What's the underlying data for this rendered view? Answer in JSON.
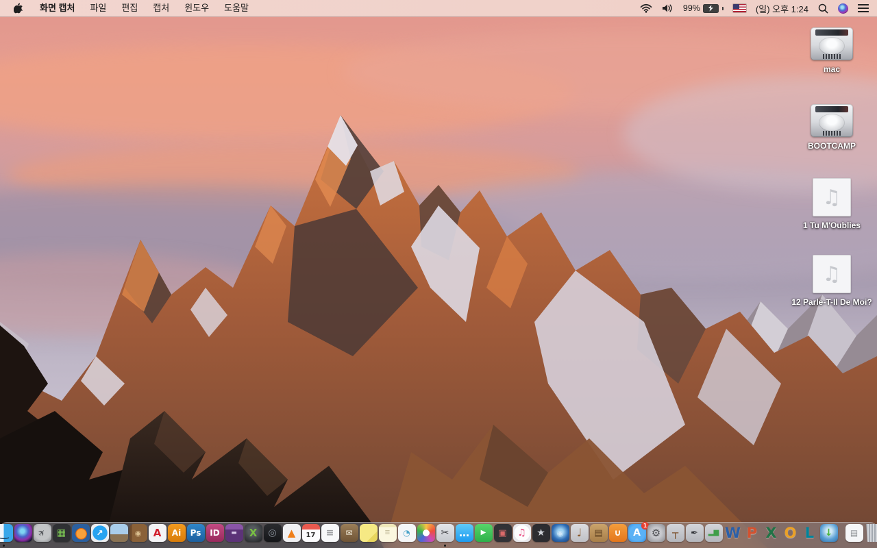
{
  "menu_bar": {
    "app_name": "화면 캡처",
    "menus": [
      "파일",
      "편집",
      "캡처",
      "윈도우",
      "도움말"
    ],
    "status": {
      "battery_percent": "99%",
      "battery_state": "charging",
      "clock": "(일) 오후 1:24",
      "input_source": "us-flag",
      "icon_names": [
        "wifi-icon",
        "volume-icon",
        "battery-charging-icon",
        "keyboard-flag-icon",
        "spotlight-icon",
        "siri-icon",
        "notification-center-icon"
      ]
    }
  },
  "desktop": {
    "wallpaper": "macos-sierra-mountain-sunset",
    "icons": [
      {
        "label": "mac",
        "type": "hard-drive"
      },
      {
        "label": "BOOTCAMP",
        "type": "hard-drive"
      },
      {
        "label": "1 Tu M'Oublies",
        "type": "audio-file",
        "glyph": "♫"
      },
      {
        "label": "12 Parle-T-Il De Moi?",
        "type": "audio-file",
        "glyph": "♫"
      }
    ]
  },
  "dock": {
    "apps": [
      {
        "name": "finder",
        "bg": "linear-gradient(90deg,#f2f6fa 0 49%,#39a7ea 49% 100%)",
        "glyph": "‿",
        "fg": "#1c3d5a",
        "fs": 17,
        "running": true
      },
      {
        "name": "siri",
        "bg": "radial-gradient(circle at 45% 40%,#7fd4f2 0 14%,#4a63c9 40%,#902ea8 62%,#121430 86%)",
        "glyph": ""
      },
      {
        "name": "launchpad",
        "bg": "radial-gradient(circle at 50% 45%,#c3c5c7 0 58%,#86898d 100%)",
        "glyph": "✈",
        "fg": "#4c4f54",
        "fs": 13,
        "tilt": -45
      },
      {
        "name": "mission-control",
        "bg": "#2f3033",
        "glyph": "▦",
        "fg": "#7dc855",
        "fs": 14
      },
      {
        "name": "firefox",
        "bg": "radial-gradient(circle at 52% 55%,#f9a13b 0 36%,#e06b12 37% 42%,#2b5f9e 43% 100%)",
        "glyph": ""
      },
      {
        "name": "safari",
        "bg": "radial-gradient(circle at 50% 50%,#27a3f0 0 58%,#eceef0 59% 100%)",
        "glyph": "↗",
        "fg": "#ffffff",
        "fs": 12
      },
      {
        "name": "preview",
        "bg": "linear-gradient(180deg,#a9cdea 0 58%,#8a7354 58% 100%)",
        "glyph": ""
      },
      {
        "name": "contacts",
        "bg": "linear-gradient(90deg,#6d4a2b 0 14%,#8a6138 14% 100%)",
        "glyph": "◉",
        "fg": "#d9bd8d",
        "fs": 11
      },
      {
        "name": "acrobat",
        "bg": "#f4f4f6",
        "glyph": "A",
        "fg": "#d2202f",
        "fs": 15
      },
      {
        "name": "illustrator",
        "bg": "linear-gradient(180deg,#f39a1e,#d97c0a)",
        "glyph": "Ai",
        "fg": "#ffffff",
        "fs": 12
      },
      {
        "name": "photoshop",
        "bg": "linear-gradient(180deg,#2f86c9,#1d5f9e)",
        "glyph": "Ps",
        "fg": "#ffffff",
        "fs": 12
      },
      {
        "name": "indesign",
        "bg": "linear-gradient(180deg,#c24a82,#98295c)",
        "glyph": "ID",
        "fg": "#ffffff",
        "fs": 12
      },
      {
        "name": "toast",
        "bg": "linear-gradient(180deg,#8a55a8 0 30%,#5c3378 30% 100%)",
        "glyph": "▬",
        "fg": "#d8c8e8",
        "fs": 9
      },
      {
        "name": "green-x-app",
        "bg": "radial-gradient(circle at 45% 40%,#555a5e 0 30%,#1c1e20 100%)",
        "glyph": "X",
        "fg": "#79c043",
        "fs": 15
      },
      {
        "name": "disc-drive-app",
        "bg": "linear-gradient(180deg,#2a2b2e,#151619)",
        "glyph": "◎",
        "fg": "#8f96a0",
        "fs": 14
      },
      {
        "name": "vlc",
        "bg": "#f0f0f2",
        "glyph": "▲",
        "fg": "#ef7f1a",
        "fs": 15
      },
      {
        "name": "calendar",
        "bg": "linear-gradient(180deg,#e9594e 0 30%,#fbfbfd 30% 100%)",
        "glyph": "17",
        "fg": "#333333",
        "fs": 10,
        "cls": "cal"
      },
      {
        "name": "reminders",
        "bg": "#f7f8f9",
        "glyph": "≡",
        "fg": "#9a9b9e",
        "fs": 14
      },
      {
        "name": "mailbox-app",
        "bg": "linear-gradient(180deg,#9b7e58,#6f5436)",
        "glyph": "✉",
        "fg": "#f0ead8",
        "fs": 12
      },
      {
        "name": "stickies",
        "bg": "linear-gradient(135deg,#f6e984 0 70%,#e8d65e 70% 100%)",
        "glyph": ""
      },
      {
        "name": "notepad-app",
        "bg": "linear-gradient(180deg,#efe6b8 0 18%,#fbf7df 18% 100%)",
        "glyph": "≡",
        "fg": "#c9c2a0",
        "fs": 10
      },
      {
        "name": "planner-app",
        "bg": "#f5f6f7",
        "glyph": "◔",
        "fg": "#4aa3c9",
        "fs": 12
      },
      {
        "name": "photos",
        "bg": "radial-gradient(circle at 50% 50%,#ffffff 0 26%,rgba(255,255,255,0) 27%),conic-gradient(#f6c344,#ef4d3c,#c94bb5,#4a67d8,#39b54a,#f6c344)",
        "glyph": ""
      },
      {
        "name": "grab-screen-capture",
        "bg": "linear-gradient(180deg,#e3e5e9,#c6c9cf)",
        "glyph": "✂",
        "fg": "#3c3e42",
        "fs": 14,
        "running": true
      },
      {
        "name": "messages",
        "bg": "linear-gradient(180deg,#5fc9f8,#1d9bf0)",
        "glyph": "…",
        "fg": "#ffffff",
        "fs": 15
      },
      {
        "name": "facetime",
        "bg": "linear-gradient(180deg,#57d46a,#2eb14a)",
        "glyph": "▶",
        "fg": "#ffffff",
        "fs": 10
      },
      {
        "name": "photo-booth",
        "bg": "#323236",
        "glyph": "▣",
        "fg": "#d96a6a",
        "fs": 13
      },
      {
        "name": "itunes",
        "bg": "radial-gradient(circle,#fdfdfd 0 62%,#e8e8ec 63% 100%)",
        "glyph": "♫",
        "fg": "#e8457e",
        "fs": 14
      },
      {
        "name": "imovie",
        "bg": "#2c2c30",
        "glyph": "★",
        "fg": "#cfd2d8",
        "fs": 14
      },
      {
        "name": "dvd-app",
        "bg": "radial-gradient(circle at 50% 45%,#9ed1f2 0 22%,#2e6cb4 60%,#1b3f74 100%)",
        "glyph": "◉",
        "fg": "#cfe6f8",
        "fs": 11
      },
      {
        "name": "garageband",
        "bg": "linear-gradient(180deg,#dcdce0,#bfc0c6)",
        "glyph": "♩",
        "fg": "#8a5a2e",
        "fs": 16
      },
      {
        "name": "newsstand-app",
        "bg": "linear-gradient(180deg,#caa36b,#a87f49)",
        "glyph": "▤",
        "fg": "#5e4020",
        "fs": 13
      },
      {
        "name": "ibooks",
        "bg": "linear-gradient(180deg,#f49d3c,#e4761b)",
        "glyph": "∪",
        "fg": "#ffffff",
        "fs": 13
      },
      {
        "name": "app-store",
        "bg": "radial-gradient(circle,#5ab1f5 0 60%,#2f8ae0 100%)",
        "glyph": "A",
        "fg": "#ffffff",
        "fs": 14,
        "badge": "1"
      },
      {
        "name": "system-preferences",
        "bg": "radial-gradient(circle,#c8c9ce 0 40%,#88898e 100%)",
        "glyph": "⚙",
        "fg": "#4b4c50",
        "fs": 15
      },
      {
        "name": "keynote",
        "bg": "linear-gradient(180deg,#d3d5da,#b4b6bc)",
        "glyph": "┬",
        "fg": "#7a4e28",
        "fs": 15
      },
      {
        "name": "pages",
        "bg": "linear-gradient(180deg,#d3d5da,#b4b6bc)",
        "glyph": "✒",
        "fg": "#35373c",
        "fs": 13
      },
      {
        "name": "numbers",
        "bg": "linear-gradient(180deg,#d3d5da,#b4b6bc)",
        "glyph": "▂▆",
        "fg": "#3f9e49",
        "fs": 10
      },
      {
        "name": "word",
        "bg": "",
        "glyph": "W",
        "fg": "#2b5fa8",
        "cls": "office"
      },
      {
        "name": "powerpoint",
        "bg": "",
        "glyph": "P",
        "fg": "#d35230",
        "cls": "office"
      },
      {
        "name": "excel",
        "bg": "",
        "glyph": "X",
        "fg": "#217346",
        "cls": "office"
      },
      {
        "name": "outlook",
        "bg": "",
        "glyph": "O",
        "fg": "#eba127",
        "cls": "office"
      },
      {
        "name": "lync",
        "bg": "",
        "glyph": "L",
        "fg": "#00839a",
        "cls": "office"
      },
      {
        "name": "web-downloader",
        "bg": "radial-gradient(circle at 50% 40%,#cfe8f5 0 20%,#5a9fd4 60%,#2f6ea8 100%)",
        "glyph": "↓",
        "fg": "#49b53a",
        "fs": 14
      }
    ],
    "right": [
      {
        "name": "downloads-document",
        "bg": "#f5f6f8",
        "glyph": "▤",
        "fg": "#8a8d92",
        "fs": 12
      },
      {
        "name": "trash",
        "bg": "repeating-linear-gradient(90deg,#d4d7dc 0 2px,#a3a8b0 2px 4px)",
        "glyph": "",
        "cls": "trash"
      }
    ]
  }
}
